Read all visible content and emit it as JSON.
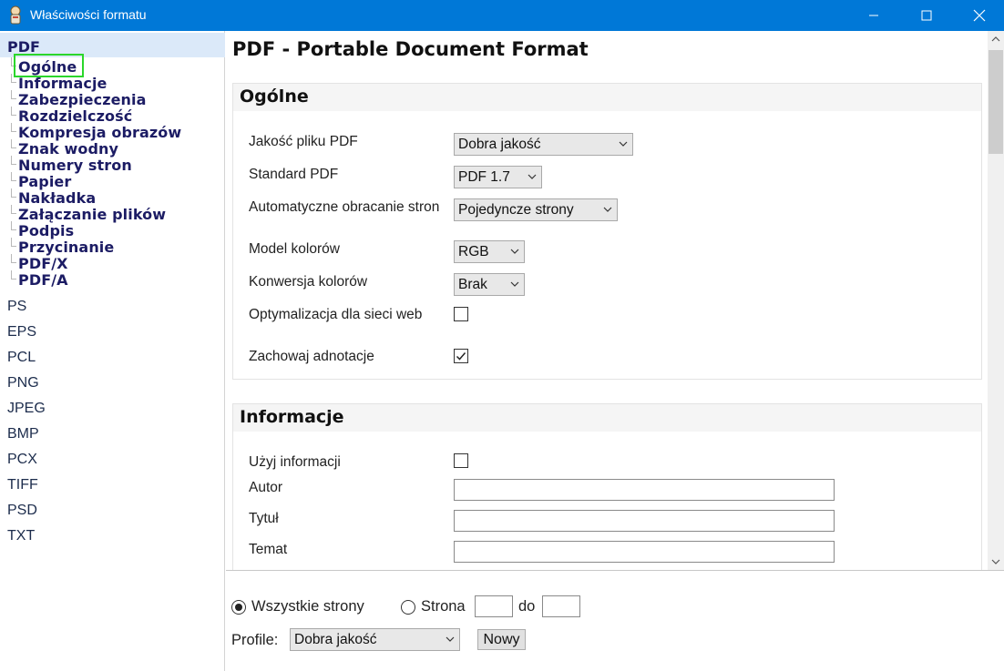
{
  "window": {
    "title": "Właściwości formatu",
    "icon": "app-icon",
    "accent_color": "#0078d7"
  },
  "sidebar": {
    "root": "PDF",
    "children": [
      "Ogólne",
      "Informacje",
      "Zabezpieczenia",
      "Rozdzielczość",
      "Kompresja obrazów",
      "Znak wodny",
      "Numery stron",
      "Papier",
      "Nakładka",
      "Załączanie plików",
      "Podpis",
      "Przycinanie",
      "PDF/X",
      "PDF/A"
    ],
    "selected": "Ogólne",
    "formats": [
      "PS",
      "EPS",
      "PCL",
      "PNG",
      "JPEG",
      "BMP",
      "PCX",
      "TIFF",
      "PSD",
      "TXT"
    ]
  },
  "main": {
    "title": "PDF - Portable Document Format",
    "general": {
      "title": "Ogólne",
      "quality_label": "Jakość pliku PDF",
      "quality_value": "Dobra jakość",
      "standard_label": "Standard PDF",
      "standard_value": "PDF 1.7",
      "rotate_label": "Automatyczne obracanie stron",
      "rotate_value": "Pojedyncze strony",
      "color_model_label": "Model kolorów",
      "color_model_value": "RGB",
      "color_conv_label": "Konwersja kolorów",
      "color_conv_value": "Brak",
      "web_opt_label": "Optymalizacja dla sieci web",
      "web_opt_checked": false,
      "keep_annot_label": "Zachowaj adnotacje",
      "keep_annot_checked": true
    },
    "info": {
      "title": "Informacje",
      "use_info_label": "Użyj informacji",
      "use_info_checked": false,
      "author_label": "Autor",
      "author_value": "",
      "title_label": "Tytuł",
      "title_value": "",
      "subject_label": "Temat",
      "subject_value": ""
    }
  },
  "bottom": {
    "all_pages_label": "Wszystkie strony",
    "page_label": "Strona",
    "to_label": "do",
    "page_from": "",
    "page_to": "",
    "profile_label": "Profile:",
    "profile_value": "Dobra jakość",
    "new_button": "Nowy"
  }
}
